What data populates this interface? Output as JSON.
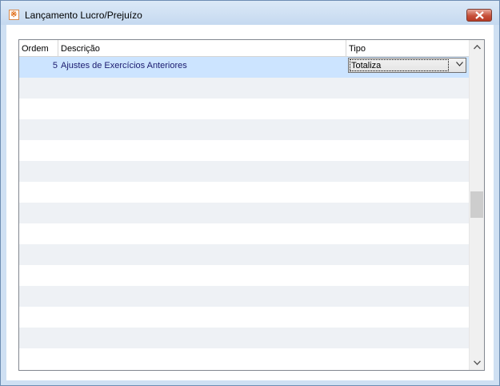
{
  "window": {
    "title": "Lançamento Lucro/Prejuízo",
    "icon": "app-logo-icon"
  },
  "grid": {
    "columns": [
      {
        "key": "ordem",
        "label": "Ordem"
      },
      {
        "key": "descricao",
        "label": "Descrição"
      },
      {
        "key": "tipo",
        "label": "Tipo"
      }
    ],
    "rows": [
      {
        "ordem": "5",
        "descricao": "Ajustes de Exercícios Anteriores",
        "tipo": "Totaliza",
        "selected": true
      }
    ],
    "empty_row_count": 14,
    "scroll_position": 0.5
  },
  "colors": {
    "selection": "#cce4ff",
    "alt_row": "#eef1f5",
    "text_link": "#1a1a6e"
  }
}
